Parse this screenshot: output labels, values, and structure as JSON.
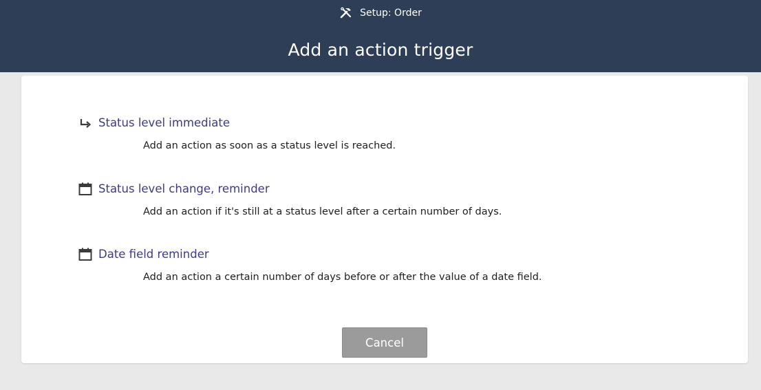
{
  "header": {
    "subtitle": "Setup: Order",
    "subtitle_icon": "tools-icon",
    "title": "Add an action trigger",
    "bg_color": "#2e3e57"
  },
  "options": [
    {
      "icon": "arrow-turn-right-icon",
      "label": "Status level immediate",
      "description": "Add an action as soon as a status level is reached."
    },
    {
      "icon": "calendar-icon",
      "label": "Status level change, reminder",
      "description": "Add an action if it's still at a status level after a certain number of days."
    },
    {
      "icon": "calendar-icon",
      "label": "Date field reminder",
      "description": "Add an action a certain number of days before or after the value of a date field."
    }
  ],
  "cancel_label": "Cancel",
  "colors": {
    "link": "#3d3a8c",
    "button": "#9b9b9b"
  }
}
